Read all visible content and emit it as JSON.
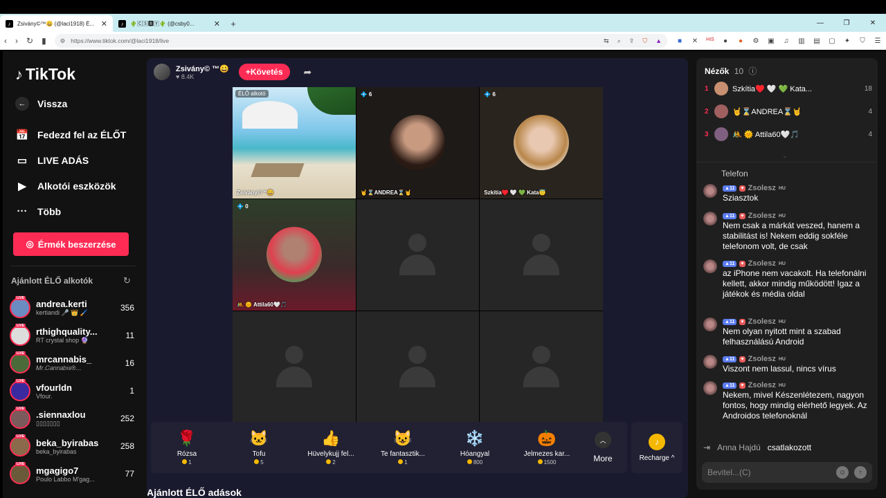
{
  "browser": {
    "tabs": [
      {
        "title": "Zsivány©™😀 (@laci1918) É...",
        "active": true
      },
      {
        "title": "🌵🄲🅂🅱🅈🌵 (@csby0...",
        "active": false
      }
    ],
    "url": "https://www.tiktok.com/@laci1918/live"
  },
  "sidebar": {
    "logo": "TikTok",
    "back": "Vissza",
    "nav": [
      {
        "label": "Fedezd fel az ÉLŐT",
        "icon": "calendar-icon"
      },
      {
        "label": "LIVE ADÁS",
        "icon": "video-camera-icon"
      },
      {
        "label": "Alkotói eszközök",
        "icon": "creator-tools-icon"
      },
      {
        "label": "Több",
        "icon": "more-dots-icon"
      }
    ],
    "coins_button": "Érmék beszerzése",
    "recommended_title": "Ajánlott ÉLŐ alkotók",
    "live_badge": "LIVE",
    "creators": [
      {
        "name": "andrea.kerti",
        "sub": "kertiandi 🎤 👑 🖌️",
        "count": "356",
        "color": "#6a8cc0"
      },
      {
        "name": "rthighquality...",
        "sub": "RT crystal shop 🔮",
        "count": "11",
        "color": "#ddd"
      },
      {
        "name": "mrcannabis_",
        "sub": "𝑀𝑟.𝐶𝑎𝑛𝑛𝑎𝑏𝑖𝑠®...",
        "count": "16",
        "color": "#4a6a3a"
      },
      {
        "name": "vfourldn",
        "sub": "Vfour.",
        "count": "1",
        "color": "#3a2aa0"
      },
      {
        "name": ".siennaxlou",
        "sub": "▯▯▯▯▯▯▯",
        "count": "252",
        "color": "#7a5a5a"
      },
      {
        "name": "beka_byirabas",
        "sub": "beka_byirabas",
        "count": "258",
        "color": "#8a6a4a"
      },
      {
        "name": "mgagigo7",
        "sub": "Poulo Labbo M'gag...",
        "count": "77",
        "color": "#6a5a3a"
      }
    ]
  },
  "stream": {
    "host_name": "Zsivány© ™😀",
    "host_likes": "8.4K",
    "follow_label": "Követés",
    "tiles": [
      {
        "label": "Zsivány©™😀",
        "tag": "ÉLŐ alkotó",
        "count": ""
      },
      {
        "label": "🤘⌛ANDREA⌛🤘",
        "count": "6",
        "tag": ""
      },
      {
        "label": "Szkítia♥️ 🤍 💚 Kata😇",
        "count": "6",
        "tag": ""
      },
      {
        "label": "🤼 🌞 Attila60🤍🎵",
        "count": "0",
        "tag": ""
      }
    ],
    "recommended_broadcasts": "Ajánlott ÉLŐ adások",
    "gifts": [
      {
        "name": "Rózsa",
        "price": "1",
        "icon": "🌹"
      },
      {
        "name": "Tofu",
        "price": "5",
        "icon": "🐱"
      },
      {
        "name": "Hüvelykujj fel...",
        "price": "2",
        "icon": "👍"
      },
      {
        "name": "Te fantasztik...",
        "price": "1",
        "icon": "😺"
      },
      {
        "name": "Hóangyal",
        "price": "800",
        "icon": "❄️"
      },
      {
        "name": "Jelmezes kar...",
        "price": "1500",
        "icon": "🎃"
      }
    ],
    "more_label": "More",
    "recharge_label": "Recharge"
  },
  "chat": {
    "viewers_label": "Nézők",
    "viewers_count": "10",
    "top_viewers": [
      {
        "rank": "1",
        "name": "Szkítia♥️ 🤍 💚 Kata...",
        "count": "18",
        "color": "#c89070"
      },
      {
        "rank": "2",
        "name": "🤘⌛ANDREA⌛🤘",
        "count": "4",
        "color": "#a06060"
      },
      {
        "rank": "3",
        "name": "🤼 🌞 Attila60🤍🎵",
        "count": "4",
        "color": "#806080"
      }
    ],
    "partial_message": "Telefon",
    "messages": [
      {
        "user": "Zsolesz",
        "level": "11",
        "text": "Sziasztok"
      },
      {
        "user": "Zsolesz",
        "level": "11",
        "text": "Nem csak a márkát veszed, hanem a stabilitást is! Nekem eddig sokféle telefonom volt, de csak"
      },
      {
        "user": "Zsolesz",
        "level": "11",
        "text": "az iPhone nem vacakolt. Ha telefonálni kellett, akkor mindig működött! Igaz a játékok és média oldal"
      },
      {
        "user": "Zsolesz",
        "level": "11",
        "text": "Nem olyan nyitott mint a szabad felhasználású Android"
      },
      {
        "user": "Zsolesz",
        "level": "11",
        "text": "Viszont nem lassul, nincs vírus"
      },
      {
        "user": "Zsolesz",
        "level": "11",
        "text": "Nekem, mivel Készenlétezem, nagyon fontos, hogy mindig elérhető legyek. Az Androidos telefonoknál"
      }
    ],
    "hu_label": "HU",
    "joined_user": "Anna Hajdú",
    "joined_text": "csatlakozott",
    "input_placeholder": "Bevitel...(C)"
  }
}
